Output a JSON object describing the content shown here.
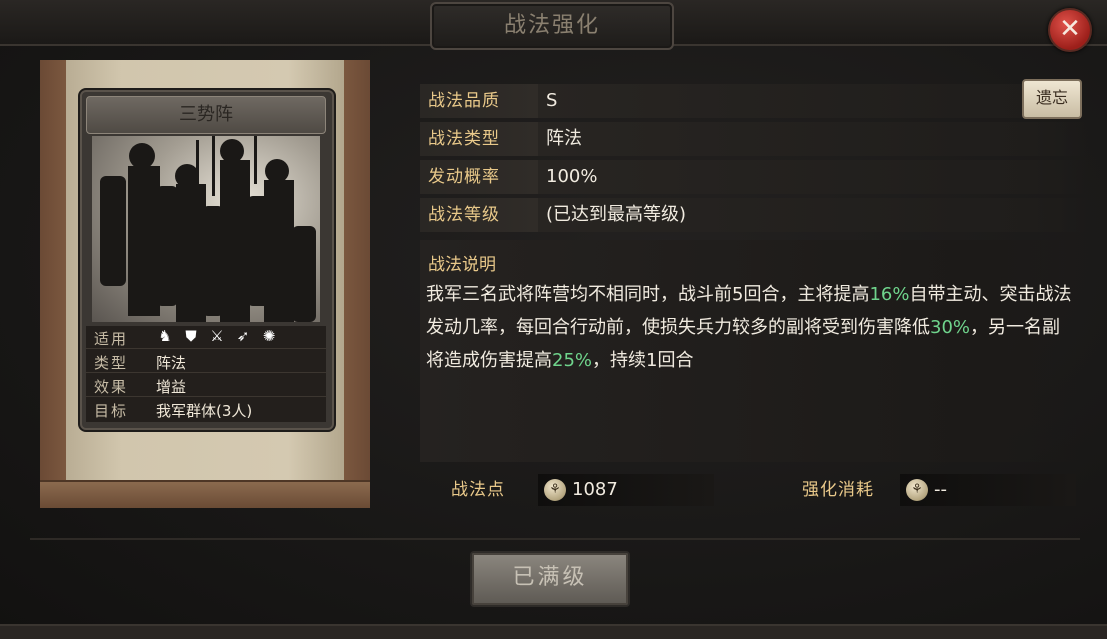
{
  "window": {
    "title": "战法强化",
    "close_symbol": "✕"
  },
  "card": {
    "name": "三势阵",
    "info": [
      {
        "key": "适用",
        "icons": [
          "cavalry-icon",
          "shield-icon",
          "bow-icon",
          "spear-icon",
          "chariot-icon"
        ]
      },
      {
        "key": "类型",
        "value": "阵法"
      },
      {
        "key": "效果",
        "value": "增益"
      },
      {
        "key": "目标",
        "value": "我军群体(3人)"
      }
    ]
  },
  "details": {
    "quality": {
      "label": "战法品质",
      "value": "S"
    },
    "type": {
      "label": "战法类型",
      "value": "阵法"
    },
    "chance": {
      "label": "发动概率",
      "value": "100%"
    },
    "level": {
      "label": "战法等级",
      "value": "(已达到最高等级)"
    }
  },
  "reset_button": "遗忘",
  "description": {
    "title": "战法说明",
    "segments": [
      {
        "t": "我军三名武将阵营均不相同时，战斗前"
      },
      {
        "t": "5"
      },
      {
        "t": "回合，主将提高"
      },
      {
        "t": "16%",
        "green": true
      },
      {
        "t": "自带主动、突击战法发动几率，每回合行动前，使损失兵力较多的副将受到伤害降低"
      },
      {
        "t": "30%",
        "green": true
      },
      {
        "t": "，另一名副将造成伤害提高"
      },
      {
        "t": "25%",
        "green": true
      },
      {
        "t": "，持续"
      },
      {
        "t": "1"
      },
      {
        "t": "回合"
      }
    ]
  },
  "points": {
    "label": "战法点",
    "value": "1087"
  },
  "cost": {
    "label": "强化消耗",
    "value": "--"
  },
  "max_button": "已满级",
  "colors": {
    "accent_gold": "#e9c98a",
    "highlight_green": "#6fd48c",
    "close_red": "#c93a32"
  }
}
